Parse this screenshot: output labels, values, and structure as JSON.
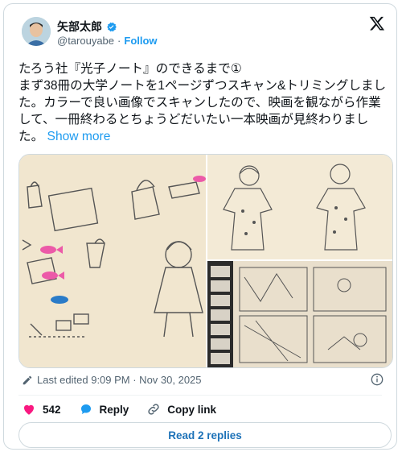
{
  "author": {
    "display_name": "矢部太郎",
    "handle": "@tarouyabe",
    "follow_label": "Follow"
  },
  "tweet": {
    "text": "たろう社『光子ノート』のできるまで①\nまず38冊の大学ノートを1ページずつスキャン&トリミングしました。カラーで良い画像でスキャンしたので、映画を観ながら作業して、一冊終わるとちょうどだいたい一本映画が見終わりました。",
    "show_more": "Show more"
  },
  "meta": {
    "edited_text": "Last edited 9:09 PM · Nov 30, 2025"
  },
  "actions": {
    "like_count": "542",
    "reply_label": "Reply",
    "copy_link_label": "Copy link"
  },
  "read_replies_label": "Read 2 replies",
  "images": [
    {
      "icon": "sketch-bags-fish-girl"
    },
    {
      "icon": "sketch-kimono-girls"
    },
    {
      "icon": "sketch-manga-pages"
    }
  ],
  "colors": {
    "accent": "#1d9bf0",
    "like": "#f91880",
    "text_secondary": "#536471"
  }
}
